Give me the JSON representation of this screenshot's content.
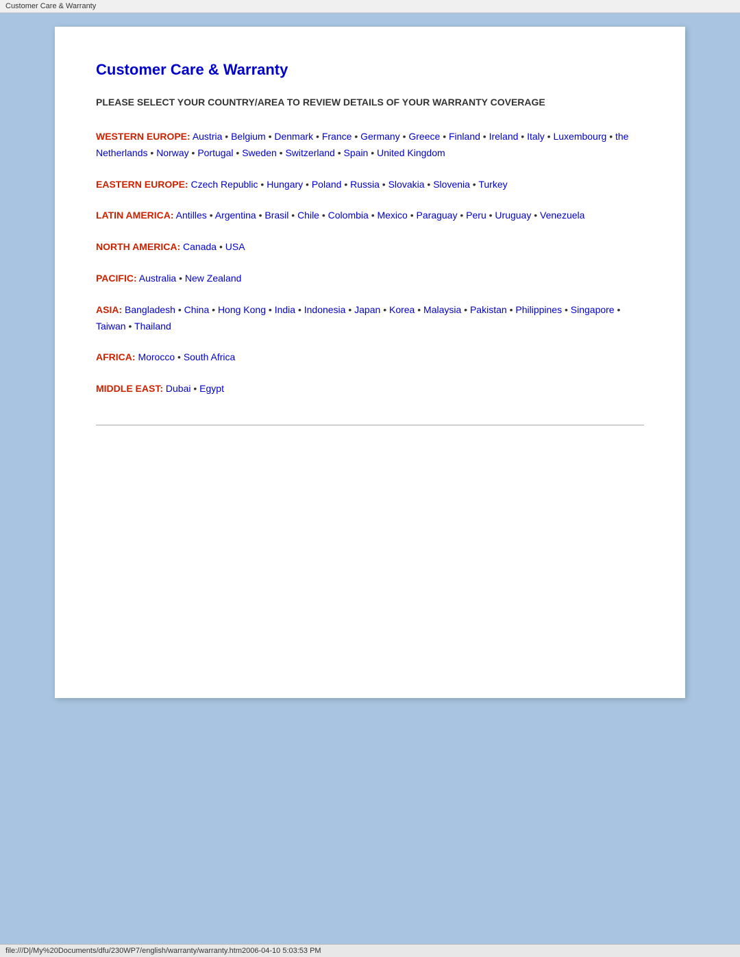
{
  "titleBar": {
    "text": "Customer Care & Warranty"
  },
  "page": {
    "title": "Customer Care & Warranty",
    "subtitle": "PLEASE SELECT YOUR COUNTRY/AREA TO REVIEW DETAILS OF YOUR WARRANTY COVERAGE",
    "regions": [
      {
        "id": "western-europe",
        "label": "WESTERN EUROPE:",
        "countries": [
          "Austria",
          "Belgium",
          "Denmark",
          "France",
          "Germany",
          "Greece",
          "Finland",
          "Ireland",
          "Italy",
          "Luxembourg",
          "the Netherlands",
          "Norway",
          "Portugal",
          "Sweden",
          "Switzerland",
          "Spain",
          "United Kingdom"
        ]
      },
      {
        "id": "eastern-europe",
        "label": "EASTERN EUROPE:",
        "countries": [
          "Czech Republic",
          "Hungary",
          "Poland",
          "Russia",
          "Slovakia",
          "Slovenia",
          "Turkey"
        ]
      },
      {
        "id": "latin-america",
        "label": "LATIN AMERICA:",
        "countries": [
          "Antilles",
          "Argentina",
          "Brasil",
          "Chile",
          "Colombia",
          "Mexico",
          "Paraguay",
          "Peru",
          "Uruguay",
          "Venezuela"
        ]
      },
      {
        "id": "north-america",
        "label": "NORTH AMERICA:",
        "countries": [
          "Canada",
          "USA"
        ]
      },
      {
        "id": "pacific",
        "label": "PACIFIC:",
        "countries": [
          "Australia",
          "New Zealand"
        ]
      },
      {
        "id": "asia",
        "label": "ASIA:",
        "countries": [
          "Bangladesh",
          "China",
          "Hong Kong",
          "India",
          "Indonesia",
          "Japan",
          "Korea",
          "Malaysia",
          "Pakistan",
          "Philippines",
          "Singapore",
          "Taiwan",
          "Thailand"
        ]
      },
      {
        "id": "africa",
        "label": "AFRICA:",
        "countries": [
          "Morocco",
          "South Africa"
        ]
      },
      {
        "id": "middle-east",
        "label": "MIDDLE EAST:",
        "countries": [
          "Dubai",
          "Egypt"
        ]
      }
    ]
  },
  "statusBar": {
    "text": "file:///D|/My%20Documents/dfu/230WP7/english/warranty/warranty.htm2006-04-10  5:03:53 PM"
  }
}
